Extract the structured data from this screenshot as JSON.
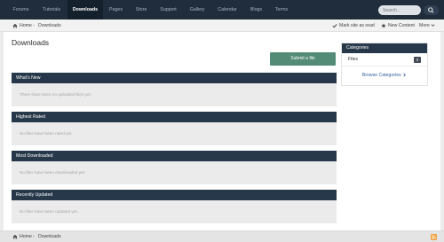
{
  "nav": {
    "items": [
      {
        "label": "Forums"
      },
      {
        "label": "Tutorials"
      },
      {
        "label": "Downloads"
      },
      {
        "label": "Pages"
      },
      {
        "label": "Store"
      },
      {
        "label": "Support"
      },
      {
        "label": "Gallery"
      },
      {
        "label": "Calendar"
      },
      {
        "label": "Blogs"
      },
      {
        "label": "Terms"
      }
    ],
    "active": "Downloads",
    "search_placeholder": "Search..."
  },
  "breadcrumb": {
    "home": "Home",
    "separator": "›",
    "current": "Downloads"
  },
  "quick_actions": {
    "mark_read": "Mark site as read",
    "new_content": "New Content",
    "more": "More"
  },
  "page": {
    "title": "Downloads",
    "submit_label": "Submit a file"
  },
  "panels": [
    {
      "title": "What's New",
      "empty": "There have been no uploaded files yet."
    },
    {
      "title": "Highest Rated",
      "empty": "No files have been rated yet."
    },
    {
      "title": "Most Downloaded",
      "empty": "No files have been downloaded yet."
    },
    {
      "title": "Recently Updated",
      "empty": "No files have been updated yet."
    }
  ],
  "sidebar": {
    "title": "Categories",
    "category": "Files",
    "count": "0",
    "browse": "Browse Categories"
  },
  "footer": {
    "home": "Home",
    "separator": "›",
    "current": "Downloads"
  },
  "colors": {
    "nav_bg": "#1f2d3d",
    "panel_header": "#26384a",
    "submit_button": "#538b76",
    "link": "#2c5f9b",
    "rss": "#f0a040"
  }
}
